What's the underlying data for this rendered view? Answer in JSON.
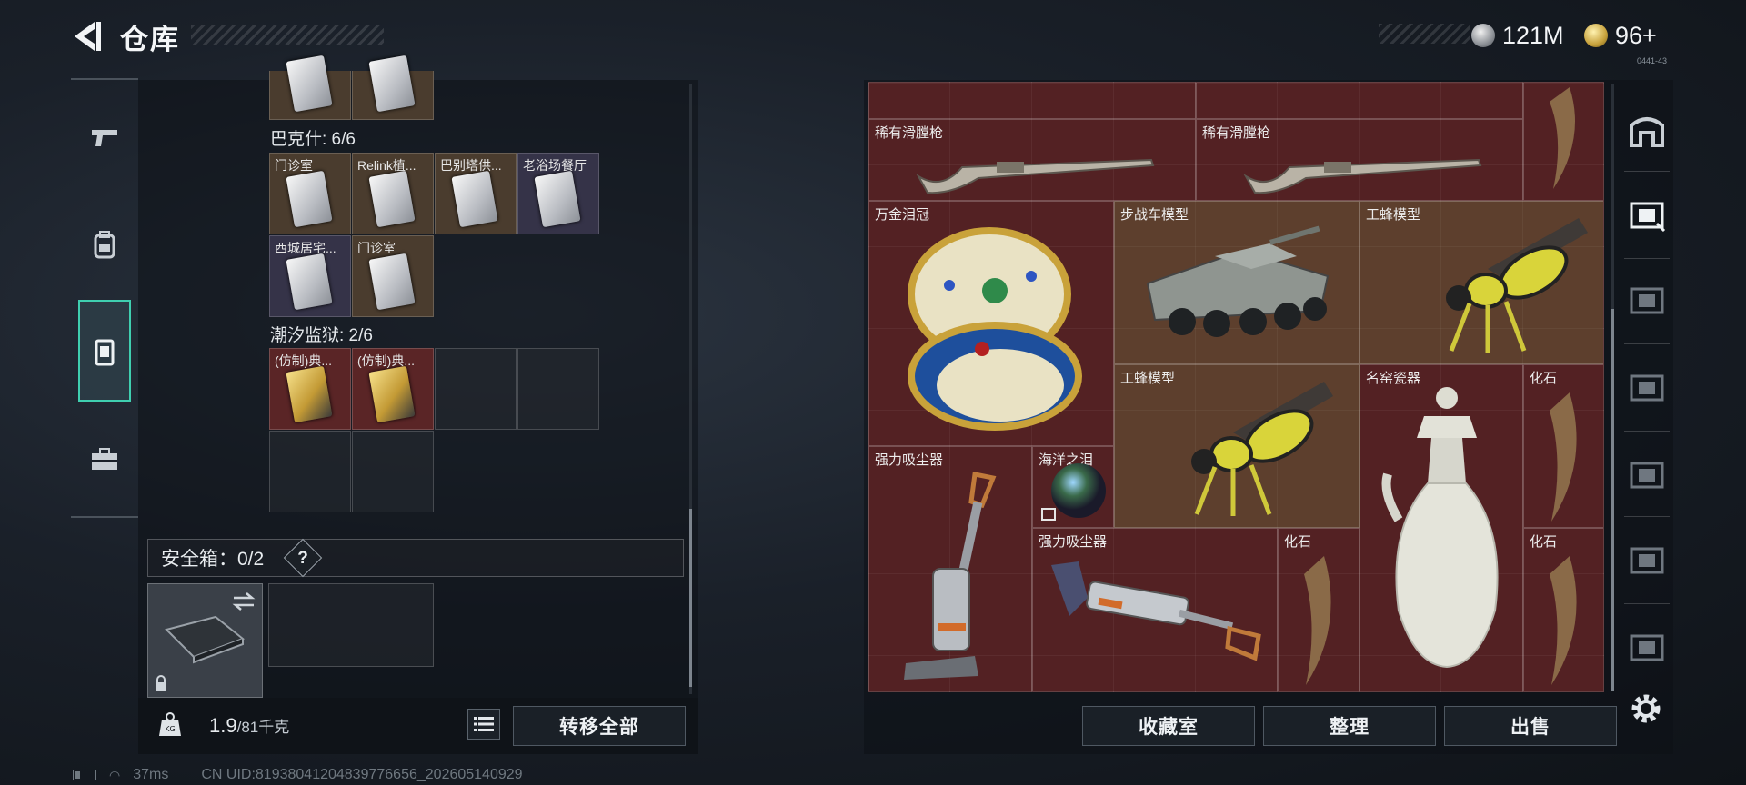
{
  "header": {
    "title": "仓库",
    "currency_silver": "121M",
    "currency_gold": "96+"
  },
  "left_nav": [
    "gun-icon",
    "backpack-icon",
    "container-icon",
    "toolbox-icon"
  ],
  "collections": [
    {
      "title": "巴克什: 6/6",
      "items": [
        "门诊室",
        "Relink植...",
        "巴别塔供...",
        "老浴场餐厅",
        "西城居宅...",
        "门诊室"
      ]
    },
    {
      "title": "潮汐监狱: 2/6",
      "items": [
        "(仿制)典...",
        "(仿制)典..."
      ]
    }
  ],
  "safe_box": {
    "label": "安全箱：0/2",
    "help": "?"
  },
  "weight": {
    "current": "1.9",
    "max": "/81千克"
  },
  "buttons": {
    "transfer_all": "转移全部",
    "collection_room": "收藏室",
    "organize": "整理",
    "sell": "出售"
  },
  "stash_items": [
    "稀有滑膛枪",
    "稀有滑膛枪",
    "万金泪冠",
    "步战车模型",
    "工蜂模型",
    "工蜂模型",
    "名窑瓷器",
    "化石",
    "强力吸尘器",
    "海洋之泪",
    "强力吸尘器",
    "化石",
    "化石"
  ],
  "status": {
    "ping": "37ms",
    "uid": "CN UID:8193804120483977665​6_202605140929"
  },
  "version": "0441-43"
}
